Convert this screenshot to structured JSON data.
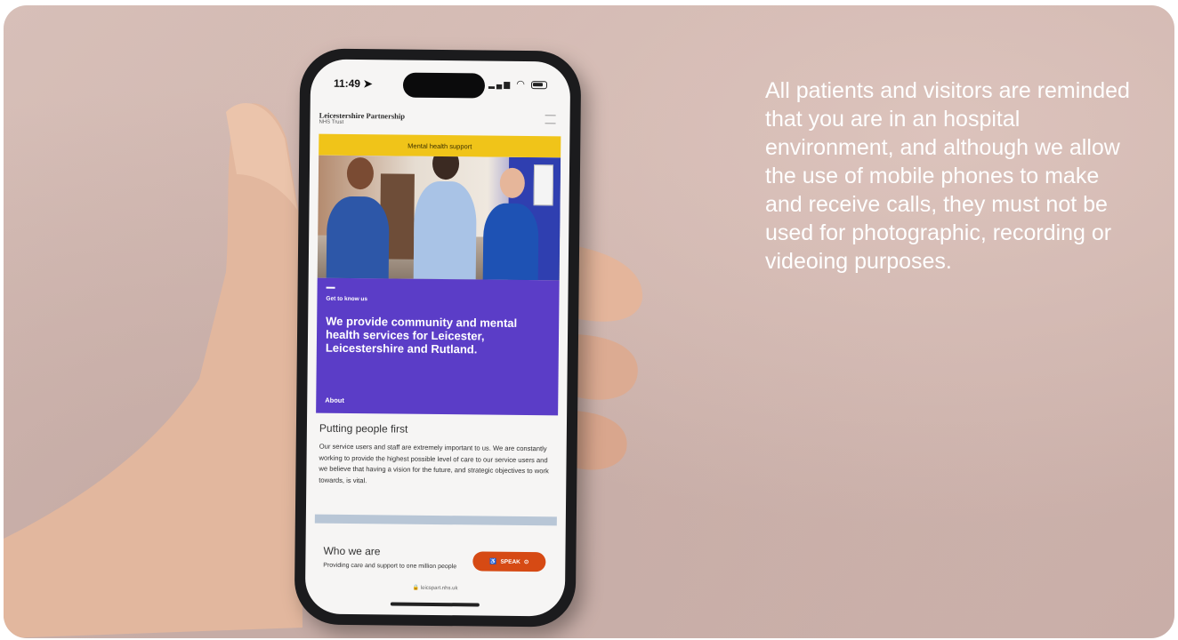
{
  "notice_text": "All patients and visitors are reminded that you are in an hospital environment, and although we allow the use of mobile phones to make and receive calls, they must not be used for photographic, recording or videoing purposes.",
  "phone": {
    "status_time": "11:49",
    "site_title": "Leicestershire Partnership",
    "site_subtitle": "NHS Trust",
    "banner": "Mental health support",
    "card_kicker": "Get to know us",
    "card_heading": "We provide community and mental health services for Leicester, Leicestershire and Rutland.",
    "card_link": "About",
    "section_title": "Putting people first",
    "section_body": "Our service users and staff are extremely important to us. We are constantly working to provide the highest possible level of care to our service users and we believe that having a vision for the future, and strategic objectives to work towards, is vital.",
    "who_title": "Who we are",
    "who_body": "Providing care and support to one million people",
    "speak_label": "SPEAK",
    "url": "leicspart.nhs.uk"
  },
  "icons": [
    "location-arrow-icon",
    "signal-icon",
    "wifi-icon",
    "battery-icon",
    "menu-icon",
    "accessibility-icon",
    "chevron-right-icon",
    "lock-icon"
  ],
  "colors": {
    "background": "#d3bab3",
    "banner_yellow": "#f0c419",
    "card_purple": "#5b3dc7",
    "speak_orange": "#d64a14",
    "notice_text": "#ffffff"
  }
}
